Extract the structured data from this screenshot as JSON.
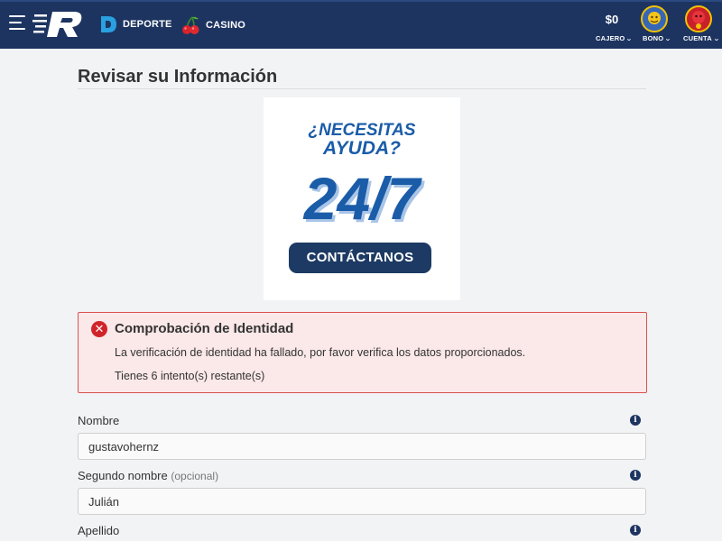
{
  "header": {
    "nav": [
      {
        "label": "DEPORTE",
        "icon": "deporte-d-icon"
      },
      {
        "label": "CASINO",
        "icon": "cherry-icon"
      }
    ],
    "balance": "$0",
    "cajero_label": "CAJERO",
    "bono_label": "BONO",
    "cuenta_label": "CUENTA",
    "colors": {
      "bar": "#1d3461",
      "accent": "#1a5ca8"
    }
  },
  "page": {
    "title": "Revisar su Información"
  },
  "help_banner": {
    "line1": "¿NECESITAS",
    "line2": "AYUDA?",
    "hours": "24/7",
    "cta": "CONTÁCTANOS"
  },
  "alert": {
    "title": "Comprobación de Identidad",
    "message": "La verificación de identidad ha fallado, por favor verifica los datos proporcionados.",
    "attempts": "Tienes 6 intento(s) restante(s)",
    "colors": {
      "border": "#d9534f",
      "background": "#fbe8e9",
      "icon": "#d0242b"
    }
  },
  "form": {
    "fields": [
      {
        "label": "Nombre",
        "optional": "",
        "value": "gustavohernz"
      },
      {
        "label": "Segundo nombre",
        "optional": "(opcional)",
        "value": "Julián"
      },
      {
        "label": "Apellido",
        "optional": "",
        "value": ""
      }
    ]
  }
}
